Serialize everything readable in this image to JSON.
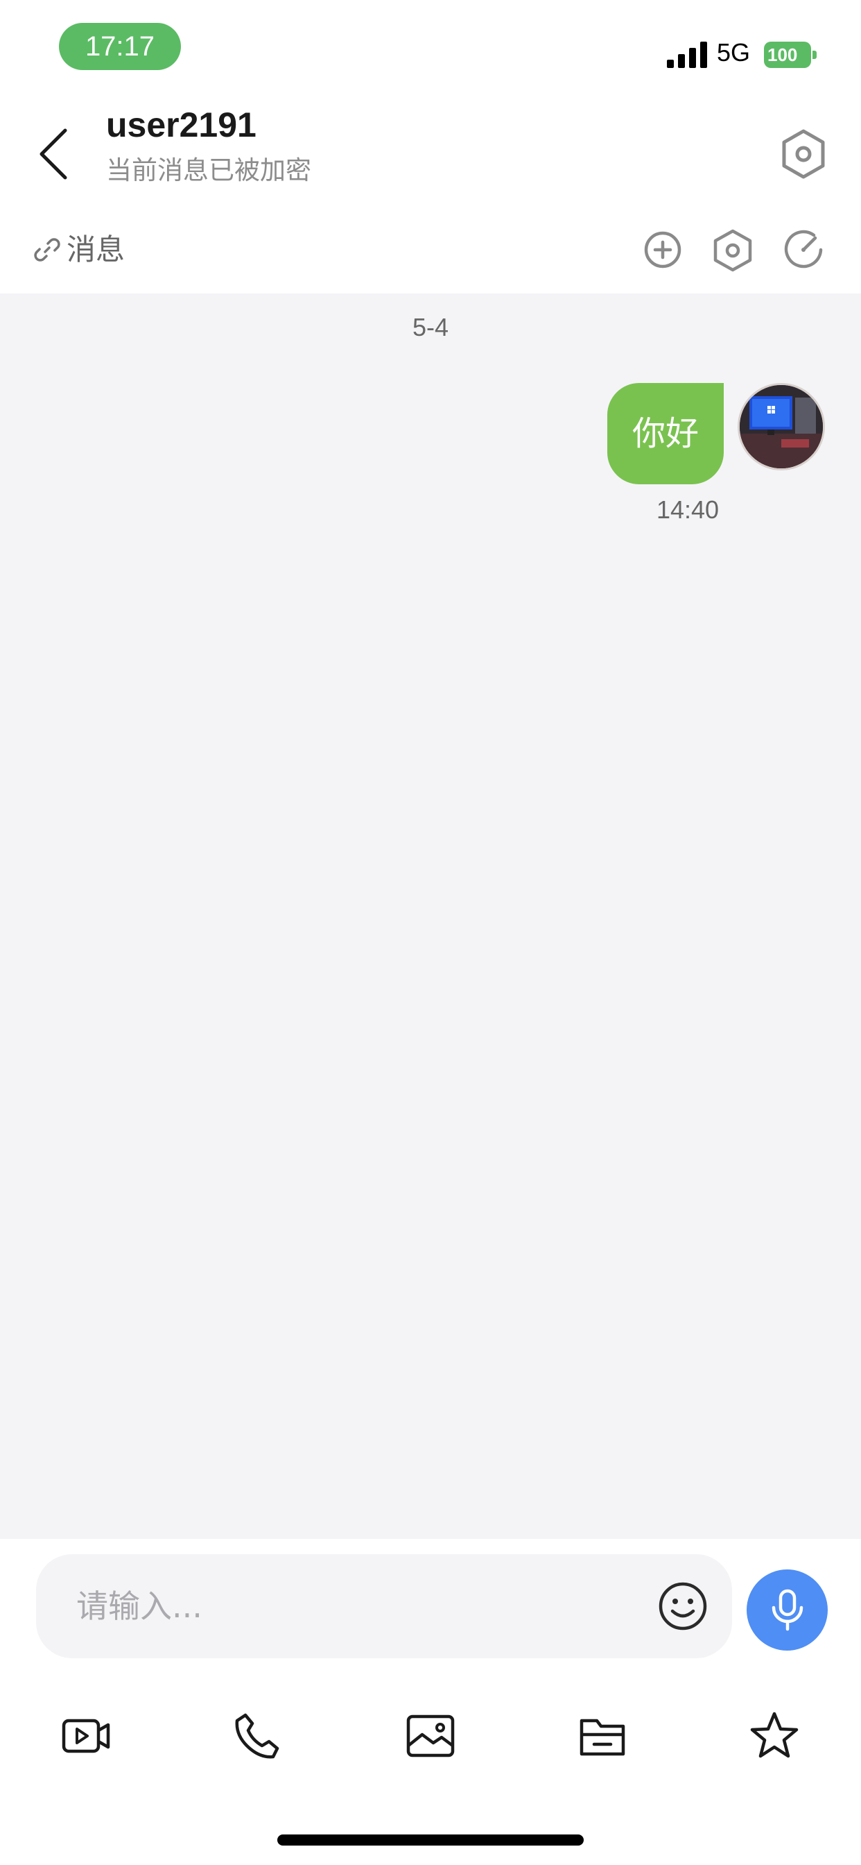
{
  "status_bar": {
    "time": "17:17",
    "network": "5G",
    "battery": "100",
    "battery_level": 1.0,
    "accent_color": "#5bbb64"
  },
  "header": {
    "back_icon": "chevron-left-icon",
    "contact_name": "user2191",
    "subtitle": "当前消息已被加密",
    "settings_icon": "hexagon-settings-icon"
  },
  "toolbar": {
    "link_icon": "link-icon",
    "label": "消息",
    "actions": [
      {
        "icon": "plus-circle-icon"
      },
      {
        "icon": "hexagon-settings-icon"
      },
      {
        "icon": "gauge-icon"
      }
    ]
  },
  "messages": {
    "date_divider": "5-4",
    "items": [
      {
        "direction": "outgoing",
        "text": "你好",
        "time": "14:40",
        "bubble_color": "#7ac24f"
      }
    ]
  },
  "composer": {
    "placeholder": "请输入...",
    "emoji_icon": "smiley-icon",
    "mic_icon": "microphone-icon",
    "mic_color": "#4f8ef4",
    "actions": [
      {
        "icon": "video-icon"
      },
      {
        "icon": "phone-icon"
      },
      {
        "icon": "image-icon"
      },
      {
        "icon": "folder-icon"
      },
      {
        "icon": "star-icon"
      }
    ]
  }
}
